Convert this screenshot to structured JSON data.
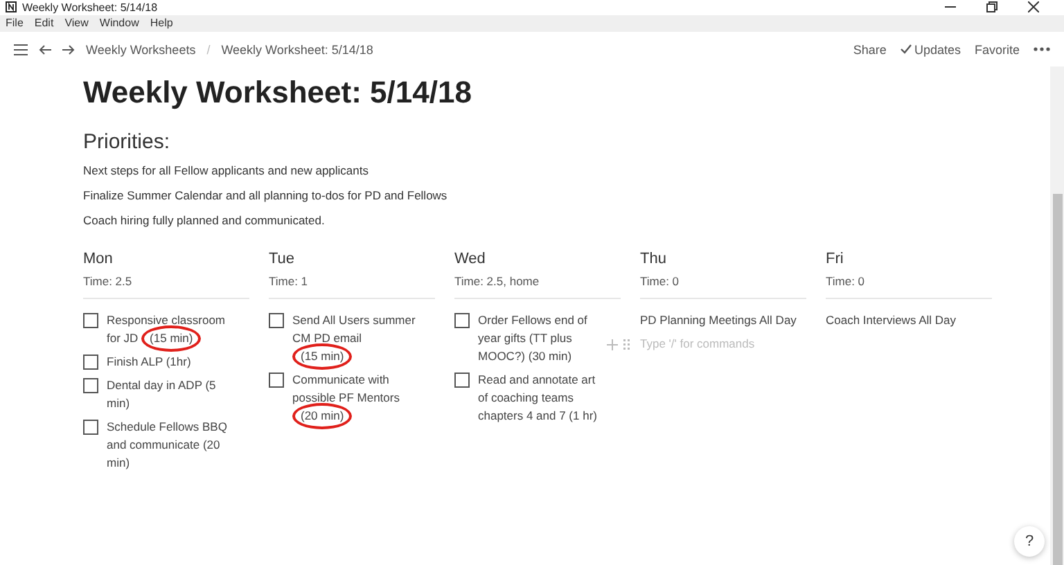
{
  "window": {
    "title": "Weekly Worksheet: 5/14/18"
  },
  "menu": [
    "File",
    "Edit",
    "View",
    "Window",
    "Help"
  ],
  "breadcrumbs": [
    "Weekly Worksheets",
    "Weekly Worksheet: 5/14/18"
  ],
  "breadcrumb_separator": "/",
  "top_actions": [
    {
      "label": "Share",
      "kind": "text"
    },
    {
      "label": "Updates",
      "kind": "check"
    },
    {
      "label": "Favorite",
      "kind": "text"
    }
  ],
  "page": {
    "title": "Weekly Worksheet: 5/14/18",
    "heading": "Priorities:",
    "lines": [
      "Next steps for all Fellow applicants and new applicants",
      "Finalize Summer Calendar and all planning to-dos for PD and Fellows",
      "Coach hiring fully planned and communicated."
    ],
    "days": [
      {
        "name": "Mon",
        "time": "Time: 2.5",
        "items": [
          {
            "kind": "todo",
            "text": "Responsive classroom for JD",
            "circled_note": "(15 min)",
            "checked": false
          },
          {
            "kind": "todo",
            "text": "Finish ALP (1hr)",
            "checked": false
          },
          {
            "kind": "todo",
            "text": "Dental day in ADP (5 min)",
            "checked": false
          },
          {
            "kind": "todo",
            "text": "Schedule Fellows BBQ and communicate (20 min)",
            "checked": false
          }
        ]
      },
      {
        "name": "Tue",
        "time": "Time: 1",
        "items": [
          {
            "kind": "todo",
            "text": "Send All Users summer CM PD email",
            "circled_note": "(15 min)",
            "checked": false
          },
          {
            "kind": "todo",
            "text": "Communicate with possible PF Mentors",
            "circled_note": "(20 min)",
            "checked": false
          }
        ]
      },
      {
        "name": "Wed",
        "time": "Time: 2.5, home",
        "items": [
          {
            "kind": "todo",
            "text": "Order Fellows end of year gifts (TT plus MOOC?) (30 min)",
            "checked": false
          },
          {
            "kind": "todo",
            "text": "Read and annotate art of coaching teams chapters 4 and 7 (1 hr)",
            "checked": false
          }
        ]
      },
      {
        "name": "Thu",
        "time": "Time: 0",
        "items": [
          {
            "kind": "text",
            "text": "PD Planning Meetings All Day"
          },
          {
            "kind": "new",
            "placeholder": "Type '/' for commands"
          }
        ]
      },
      {
        "name": "Fri",
        "time": "Time: 0",
        "items": [
          {
            "kind": "text",
            "text": "Coach Interviews All Day"
          }
        ]
      }
    ]
  },
  "help": "?"
}
